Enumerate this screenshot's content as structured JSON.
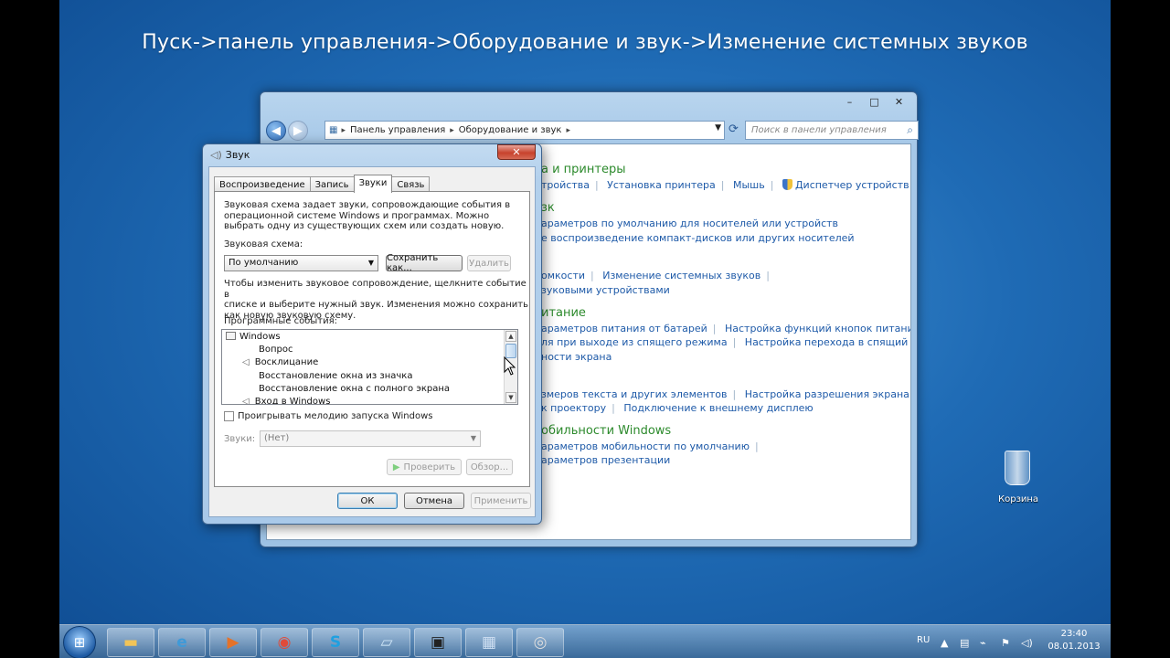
{
  "caption": "Пуск->панель управления->Оборудование и звук->Изменение системных звуков",
  "control_panel": {
    "breadcrumbs": [
      "Панель управления",
      "Оборудование и звук"
    ],
    "search_placeholder": "Поиск в панели управления",
    "window_buttons": {
      "minimize": "–",
      "maximize": "□",
      "close": "✕"
    },
    "sections": {
      "devices_heading": "а и принтеры",
      "devices_links": [
        "тройства",
        "Установка принтера",
        "Мышь",
        "Диспетчер устройств"
      ],
      "autoplay_heading": "зк",
      "autoplay_links": [
        "араметров по умолчанию для носителей или устройств",
        "е воспроизведение компакт-дисков или других носителей"
      ],
      "sound_links_1": [
        "омкости",
        "Изменение системных звуков"
      ],
      "sound_links_2": [
        "зуковыми устройствами"
      ],
      "power_heading": "итание",
      "power_links_1": [
        "араметров питания от батарей",
        "Настройка функций кнопок питания"
      ],
      "power_links_2": [
        "ля при выходе из спящего режима",
        "Настройка перехода в спящий режим"
      ],
      "power_links_3": [
        "ности экрана"
      ],
      "display_links_1": [
        "змеров текста и других элементов",
        "Настройка разрешения экрана"
      ],
      "display_links_2": [
        "к проектору",
        "Подключение к внешнему дисплею"
      ],
      "mobility_heading": "обильности Windows",
      "mobility_links": [
        "араметров мобильности по умолчанию",
        "араметров презентации"
      ]
    }
  },
  "sound_dialog": {
    "title": "Звук",
    "close_glyph": "✕",
    "tabs": [
      "Воспроизведение",
      "Запись",
      "Звуки",
      "Связь"
    ],
    "active_tab": "Звуки",
    "intro": [
      "Звуковая схема задает звуки, сопровождающие события в",
      "операционной системе Windows и программах. Можно",
      "выбрать одну из существующих схем или создать новую."
    ],
    "scheme_label": "Звуковая схема:",
    "scheme_value": "По умолчанию",
    "save_as_button": "Сохранить как...",
    "delete_button": "Удалить",
    "change_hint": [
      "Чтобы изменить звуковое сопровождение, щелкните событие в",
      "списке и выберите нужный звук. Изменения можно сохранить",
      "как новую звуковую схему."
    ],
    "events_label": "Программные события:",
    "events": [
      {
        "label": "Windows",
        "level": 0,
        "icon": "windows-icon"
      },
      {
        "label": "Вопрос",
        "level": 1,
        "icon": ""
      },
      {
        "label": "Восклицание",
        "level": 1,
        "icon": "speaker-icon"
      },
      {
        "label": "Восстановление окна из значка",
        "level": 1,
        "icon": ""
      },
      {
        "label": "Восстановление окна с полного экрана",
        "level": 1,
        "icon": ""
      },
      {
        "label": "Вход в Windows",
        "level": 1,
        "icon": "speaker-icon"
      }
    ],
    "startup_checkbox_label": "Проигрывать мелодию запуска Windows",
    "startup_checked": false,
    "sounds_label": "Звуки:",
    "sounds_value": "(Нет)",
    "test_button": "Проверить",
    "browse_button": "Обзор...",
    "ok_button": "ОК",
    "cancel_button": "Отмена",
    "apply_button": "Применить"
  },
  "desktop": {
    "recycle_bin_label": "Корзина"
  },
  "taskbar": {
    "language": "RU",
    "time": "23:40",
    "date": "08.01.2013",
    "apps": [
      "file-explorer-icon",
      "internet-explorer-icon",
      "media-player-icon",
      "chrome-icon",
      "skype-icon",
      "notes-icon",
      "camera-app-icon",
      "control-panel-icon",
      "sound-app-icon"
    ]
  }
}
